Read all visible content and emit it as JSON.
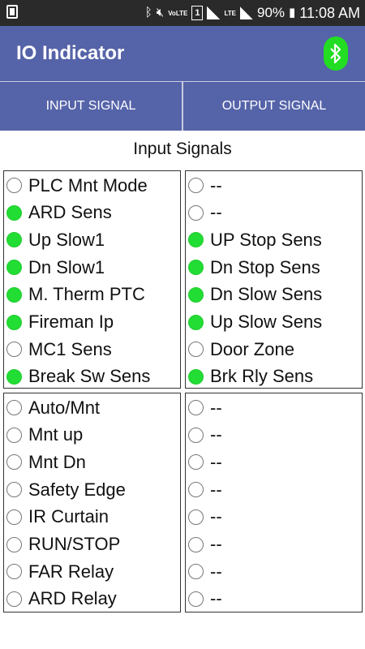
{
  "status_bar": {
    "volte": "VoLTE",
    "sim": "1",
    "lte": "LTE",
    "battery": "90%",
    "time": "11:08 AM"
  },
  "app_bar": {
    "title": "IO Indicator",
    "bluetooth_icon": "bluetooth-icon",
    "bluetooth_color": "#22dd22"
  },
  "tabs": [
    {
      "label": "INPUT SIGNAL"
    },
    {
      "label": "OUTPUT SIGNAL"
    }
  ],
  "section_title": "Input Signals",
  "colors": {
    "accent": "#5563a8",
    "on": "#22dd33"
  },
  "panels": {
    "top_left": [
      {
        "label": "PLC Mnt Mode",
        "on": false
      },
      {
        "label": "ARD Sens",
        "on": true
      },
      {
        "label": "Up Slow1",
        "on": true
      },
      {
        "label": "Dn Slow1",
        "on": true
      },
      {
        "label": "M. Therm PTC",
        "on": true
      },
      {
        "label": "Fireman Ip",
        "on": true
      },
      {
        "label": "MC1 Sens",
        "on": false
      },
      {
        "label": "Break Sw Sens",
        "on": true
      }
    ],
    "top_right": [
      {
        "label": "--",
        "on": false
      },
      {
        "label": "--",
        "on": false
      },
      {
        "label": "UP Stop Sens",
        "on": true
      },
      {
        "label": "Dn Stop Sens",
        "on": true
      },
      {
        "label": "Dn Slow Sens",
        "on": true
      },
      {
        "label": "Up Slow Sens",
        "on": true
      },
      {
        "label": "Door Zone",
        "on": false
      },
      {
        "label": "Brk Rly Sens",
        "on": true
      }
    ],
    "bottom_left": [
      {
        "label": "Auto/Mnt",
        "on": false
      },
      {
        "label": "Mnt up",
        "on": false
      },
      {
        "label": "Mnt Dn",
        "on": false
      },
      {
        "label": "Safety Edge",
        "on": false
      },
      {
        "label": "IR Curtain",
        "on": false
      },
      {
        "label": "RUN/STOP",
        "on": false
      },
      {
        "label": "FAR Relay",
        "on": false
      },
      {
        "label": "ARD Relay",
        "on": false
      }
    ],
    "bottom_right": [
      {
        "label": "--",
        "on": false
      },
      {
        "label": "--",
        "on": false
      },
      {
        "label": "--",
        "on": false
      },
      {
        "label": "--",
        "on": false
      },
      {
        "label": "--",
        "on": false
      },
      {
        "label": "--",
        "on": false
      },
      {
        "label": "--",
        "on": false
      },
      {
        "label": "--",
        "on": false
      }
    ]
  }
}
